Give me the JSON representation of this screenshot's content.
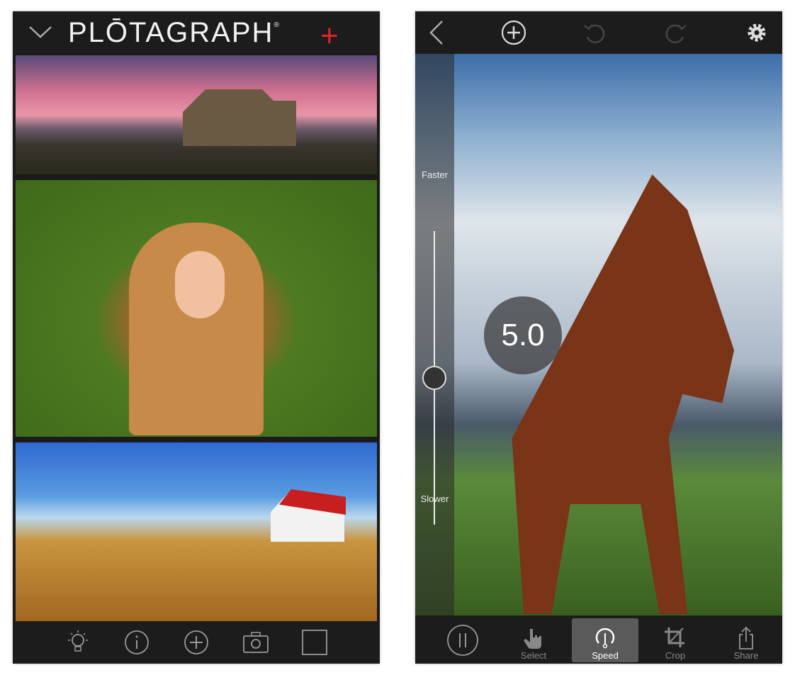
{
  "left_screen": {
    "header": {
      "brand": "PLŌTAGRAPH",
      "registered": "®",
      "plus": "+",
      "brand_color": "#e0222a"
    },
    "gallery": [
      "church-sunset-photo",
      "lion-costume-child-photo",
      "red-roof-house-photo"
    ],
    "toolbar": [
      "lightbulb-icon",
      "info-icon",
      "add-icon",
      "camera-icon",
      "square-icon"
    ]
  },
  "right_screen": {
    "top_bar": [
      "back-icon",
      "add-icon",
      "undo-icon",
      "redo-icon",
      "settings-icon"
    ],
    "speed_slider": {
      "top_label": "Faster",
      "bottom_label": "Slower",
      "value": "5.0",
      "level_fraction": 0.5
    },
    "toolbar": {
      "pause_icon": "pause-icon",
      "items": [
        {
          "label": "Select",
          "icon": "hand-pointer-icon"
        },
        {
          "label": "Speed",
          "icon": "speedometer-icon",
          "active": true
        },
        {
          "label": "Crop",
          "icon": "crop-icon"
        },
        {
          "label": "Share",
          "icon": "share-icon"
        }
      ]
    }
  }
}
